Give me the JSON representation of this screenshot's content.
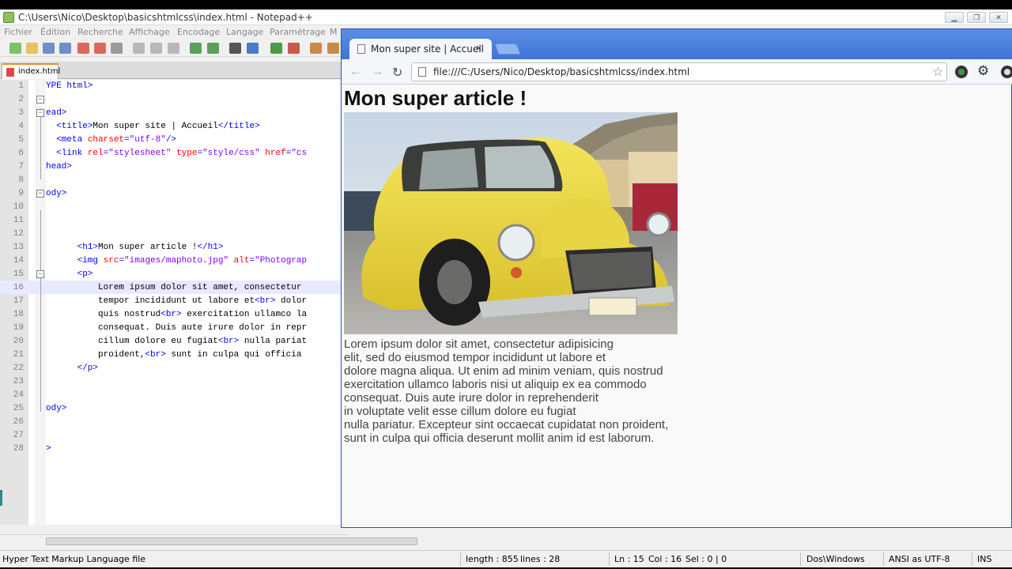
{
  "npp": {
    "title": "C:\\Users\\Nico\\Desktop\\basicshtmlcss\\index.html - Notepad++",
    "menu": [
      "Fichier",
      "Édition",
      "Recherche",
      "Affichage",
      "Encodage",
      "Langage",
      "Paramétrage",
      "M"
    ],
    "tab_label": "index.html",
    "lines": [
      {
        "n": "1",
        "code": [
          [
            "tag",
            "YPE html>"
          ]
        ]
      },
      {
        "n": "2",
        "code": []
      },
      {
        "n": "3",
        "code": [
          [
            "tag",
            "ead>"
          ]
        ]
      },
      {
        "n": "4",
        "code": [
          [
            "txt",
            "  "
          ],
          [
            "tag",
            "<title>"
          ],
          [
            "txt",
            "Mon super site | Accueil"
          ],
          [
            "tag",
            "</title>"
          ]
        ]
      },
      {
        "n": "5",
        "code": [
          [
            "txt",
            "  "
          ],
          [
            "tag",
            "<meta "
          ],
          [
            "attr",
            "charset"
          ],
          [
            "tag",
            "="
          ],
          [
            "val",
            "\"utf-8\""
          ],
          [
            "tag",
            "/>"
          ]
        ]
      },
      {
        "n": "6",
        "code": [
          [
            "txt",
            "  "
          ],
          [
            "tag",
            "<link "
          ],
          [
            "attr",
            "rel"
          ],
          [
            "tag",
            "="
          ],
          [
            "val",
            "\"stylesheet\" "
          ],
          [
            "attr",
            "type"
          ],
          [
            "tag",
            "="
          ],
          [
            "val",
            "\"style/css\" "
          ],
          [
            "attr",
            "href"
          ],
          [
            "tag",
            "="
          ],
          [
            "val",
            "\"cs"
          ]
        ]
      },
      {
        "n": "7",
        "code": [
          [
            "tag",
            "head>"
          ]
        ]
      },
      {
        "n": "8",
        "code": []
      },
      {
        "n": "9",
        "code": [
          [
            "tag",
            "ody>"
          ]
        ]
      },
      {
        "n": "10",
        "code": []
      },
      {
        "n": "11",
        "code": []
      },
      {
        "n": "12",
        "code": []
      },
      {
        "n": "13",
        "code": [
          [
            "txt",
            "      "
          ],
          [
            "tag",
            "<h1>"
          ],
          [
            "txt",
            "Mon super article !"
          ],
          [
            "tag",
            "</h1>"
          ]
        ]
      },
      {
        "n": "14",
        "code": [
          [
            "txt",
            "      "
          ],
          [
            "tag",
            "<img "
          ],
          [
            "attr",
            "src"
          ],
          [
            "tag",
            "="
          ],
          [
            "val",
            "\"images/maphoto.jpg\" "
          ],
          [
            "attr",
            "alt"
          ],
          [
            "tag",
            "="
          ],
          [
            "val",
            "\"Photograp"
          ]
        ]
      },
      {
        "n": "15",
        "code": [
          [
            "txt",
            "      "
          ],
          [
            "tag",
            "<p>"
          ]
        ]
      },
      {
        "n": "16",
        "code": [
          [
            "txt",
            "          Lorem ipsum dolor sit amet, consectetur"
          ]
        ]
      },
      {
        "n": "17",
        "code": [
          [
            "txt",
            "          tempor incididunt ut labore et"
          ],
          [
            "tag",
            "<br>"
          ],
          [
            "txt",
            " dolor"
          ]
        ]
      },
      {
        "n": "18",
        "code": [
          [
            "txt",
            "          quis nostrud"
          ],
          [
            "tag",
            "<br>"
          ],
          [
            "txt",
            " exercitation ullamco la"
          ]
        ]
      },
      {
        "n": "19",
        "code": [
          [
            "txt",
            "          consequat. Duis aute irure dolor in repr"
          ]
        ]
      },
      {
        "n": "20",
        "code": [
          [
            "txt",
            "          cillum dolore eu fugiat"
          ],
          [
            "tag",
            "<br>"
          ],
          [
            "txt",
            " nulla pariat"
          ]
        ]
      },
      {
        "n": "21",
        "code": [
          [
            "txt",
            "          proident,"
          ],
          [
            "tag",
            "<br>"
          ],
          [
            "txt",
            " sunt in culpa qui officia"
          ]
        ]
      },
      {
        "n": "22",
        "code": [
          [
            "txt",
            "      "
          ],
          [
            "tag",
            "</p>"
          ]
        ]
      },
      {
        "n": "23",
        "code": []
      },
      {
        "n": "24",
        "code": []
      },
      {
        "n": "25",
        "code": [
          [
            "tag",
            "ody>"
          ]
        ]
      },
      {
        "n": "26",
        "code": []
      },
      {
        "n": "27",
        "code": []
      },
      {
        "n": "28",
        "code": [
          [
            "tag",
            ">"
          ]
        ]
      }
    ],
    "status": {
      "file_type": "Hyper Text Markup Language file",
      "length": "length : 855",
      "lines": "lines : 28",
      "ln": "Ln : 15",
      "col": "Col : 16",
      "sel": "Sel : 0 | 0",
      "eol": "Dos\\Windows",
      "encoding": "ANSI as UTF-8",
      "mode": "INS"
    }
  },
  "browser": {
    "tab_title": "Mon super site | Accueil",
    "tab_close": "×",
    "url": "file:///C:/Users/Nico/Desktop/basicshtmlcss/index.html",
    "page": {
      "h1": "Mon super article !",
      "image_alt": "yellow vintage car photo",
      "paragraph_lines": [
        "Lorem ipsum dolor sit amet, consectetur adipisicing",
        "elit, sed do eiusmod tempor incididunt ut labore et",
        "dolore magna aliqua. Ut enim ad minim veniam, quis nostrud",
        "exercitation ullamco laboris nisi ut aliquip ex ea commodo",
        "consequat. Duis aute irure dolor in reprehenderit",
        "in voluptate velit esse cillum dolore eu fugiat",
        "nulla pariatur. Excepteur sint occaecat cupidatat non proident,",
        "sunt in culpa qui officia deserunt mollit anim id est laborum."
      ]
    }
  }
}
